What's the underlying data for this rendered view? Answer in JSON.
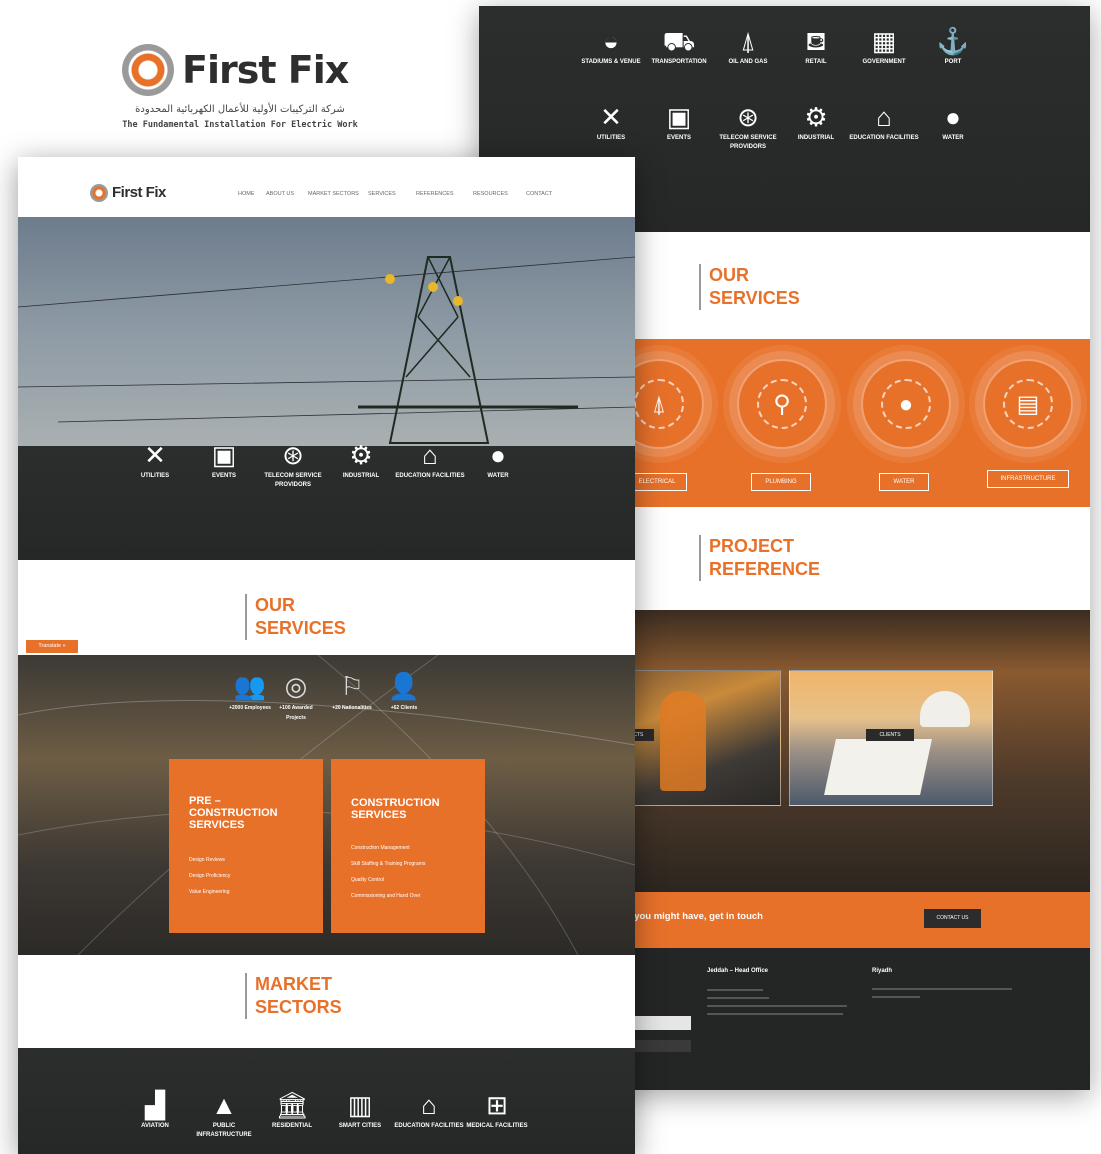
{
  "brand": {
    "name": "First Fix",
    "arabic_tagline": "شركة التركيبات الأولية للأعمال الكهربائية المحدودة",
    "english_tagline": "The Fundamental Installation For Electric Work",
    "accent_color": "#e8712a"
  },
  "back_page": {
    "sectors_row1": [
      {
        "icon": "stadium-icon",
        "label": "STADIUMS & VENUE"
      },
      {
        "icon": "train-icon",
        "label": "TRANSPORTATION"
      },
      {
        "icon": "oil-rig-icon",
        "label": "OIL AND GAS"
      },
      {
        "icon": "cart-icon",
        "label": "RETAIL"
      },
      {
        "icon": "building-icon",
        "label": "GOVERNMENT"
      },
      {
        "icon": "anchor-icon",
        "label": "PORT"
      }
    ],
    "sectors_row2": [
      {
        "icon": "tools-icon",
        "label": "UTILITIES"
      },
      {
        "icon": "calendar-icon",
        "label": "EVENTS"
      },
      {
        "icon": "antenna-icon",
        "label": "TELECOM SERVICE PROVIDORS"
      },
      {
        "icon": "factory-gear-icon",
        "label": "INDUSTRIAL"
      },
      {
        "icon": "home-icon",
        "label": "EDUCATION FACILITIES"
      },
      {
        "icon": "drop-icon",
        "label": "WATER"
      }
    ],
    "services_heading": {
      "line1": "OUR",
      "line2": "SERVICES"
    },
    "service_buttons": [
      "ELECTRICAL",
      "PLUMBING",
      "WATER",
      "INFRASTRUCTURE"
    ],
    "project_heading": {
      "line1": "PROJECT",
      "line2": "REFERENCE"
    },
    "reference_labels": [
      "PROJECTS",
      "CLIENTS"
    ],
    "cta_text": "to help and answer any questions you might have, get in touch",
    "cta_button": "CONTACT US",
    "footer": {
      "office1_title": "Jeddah – Head Office",
      "office2_title": "Riyadh"
    }
  },
  "front_page": {
    "nav": {
      "logo": "First Fix",
      "items": [
        "HOME",
        "ABOUT US",
        "MARKET SECTORS",
        "SERVICES",
        "REFERENCES",
        "RESOURCES",
        "CONTACT"
      ]
    },
    "sectors": [
      {
        "icon": "tools-icon",
        "label": "UTILITIES"
      },
      {
        "icon": "calendar-icon",
        "label": "EVENTS"
      },
      {
        "icon": "antenna-icon",
        "label": "TELECOM SERVICE PROVIDORS"
      },
      {
        "icon": "factory-gear-icon",
        "label": "INDUSTRIAL"
      },
      {
        "icon": "home-icon",
        "label": "EDUCATION FACILITIES"
      },
      {
        "icon": "drop-icon",
        "label": "WATER"
      }
    ],
    "services_heading": {
      "line1": "OUR",
      "line2": "SERVICES"
    },
    "translate_label": "Translate »",
    "stats": [
      {
        "icon": "people-icon",
        "label": "+2000 Employees"
      },
      {
        "icon": "medal-icon",
        "label": "+100 Awarded Projects"
      },
      {
        "icon": "flag-icon",
        "label": "+20 Nationalities"
      },
      {
        "icon": "clients-icon",
        "label": "+62 Clients"
      }
    ],
    "card_pre": {
      "title": "PRE – CONSTRUCTION SERVICES",
      "items": [
        "Design Reviews",
        "Design Proficiency",
        "Value Engineering"
      ]
    },
    "card_construction": {
      "title": "CONSTRUCTION SERVICES",
      "items": [
        "Construction Management",
        "Skill Staffing & Training Programs",
        "Quality Control",
        "Commissioning and Hand Over"
      ]
    },
    "market_heading": {
      "line1": "MARKET",
      "line2": "SECTORS"
    },
    "market_sectors": [
      {
        "icon": "factory-icon",
        "label": "AVIATION"
      },
      {
        "icon": "road-icon",
        "label": "PUBLIC INFRASTRUCTURE"
      },
      {
        "icon": "bank-icon",
        "label": "RESIDENTIAL"
      },
      {
        "icon": "city-icon",
        "label": "SMART CITIES"
      },
      {
        "icon": "home-icon",
        "label": "EDUCATION FACILITIES"
      },
      {
        "icon": "medical-kit-icon",
        "label": "MEDICAL FACILITIES"
      }
    ]
  }
}
